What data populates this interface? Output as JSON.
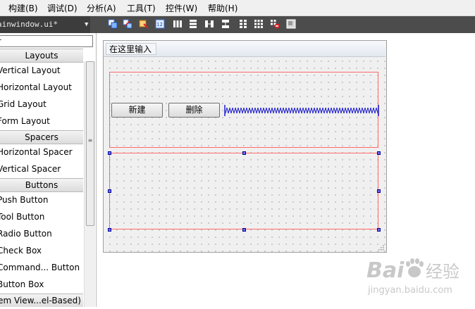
{
  "menu": [
    {
      "label": "构建(B)"
    },
    {
      "label": "调试(D)"
    },
    {
      "label": "分析(A)"
    },
    {
      "label": "工具(T)"
    },
    {
      "label": "控件(W)"
    },
    {
      "label": "帮助(H)"
    }
  ],
  "file_tab": {
    "label": "ainwindow.ui*",
    "arrow": "▼"
  },
  "toolbar_icons": [
    "edit-widgets-icon",
    "edit-signals-slots-icon",
    "edit-buddies-icon",
    "edit-tab-order-icon",
    "layout-horizontal-icon",
    "layout-vertical-icon",
    "layout-horizontal-splitter-icon",
    "layout-vertical-splitter-icon",
    "layout-form-icon",
    "layout-grid-icon",
    "break-layout-icon",
    "adjust-size-icon"
  ],
  "widget_box": {
    "filter_value": "r",
    "categories": {
      "layouts": "Layouts",
      "spacers": "Spacers",
      "buttons": "Buttons",
      "item_views": "em View...el-Based)"
    },
    "items": {
      "vertical_layout": "Vertical Layout",
      "horizontal_layout": "Horizontal Layout",
      "grid_layout": "Grid Layout",
      "form_layout": "Form Layout",
      "horizontal_spacer": "Horizontal Spacer",
      "vertical_spacer": "Vertical Spacer",
      "push_button": "Push Button",
      "tool_button": "Tool Button",
      "radio_button": "Radio Button",
      "check_box": "Check Box",
      "command_link_button": "Command... Button",
      "button_box": "Button Box"
    }
  },
  "form": {
    "menu_input": "在这里输入",
    "new_button": "新建",
    "delete_button": "删除"
  },
  "watermark": {
    "brand": "Bai",
    "brand_suffix": "经验",
    "url": "jingyan.baidu.com"
  },
  "colors": {
    "layout_border": "#ff6a6a",
    "spacer_color": "#1a1acd",
    "toolbar_bg": "#4c4c4c",
    "watermark": "#c8c8c8"
  }
}
